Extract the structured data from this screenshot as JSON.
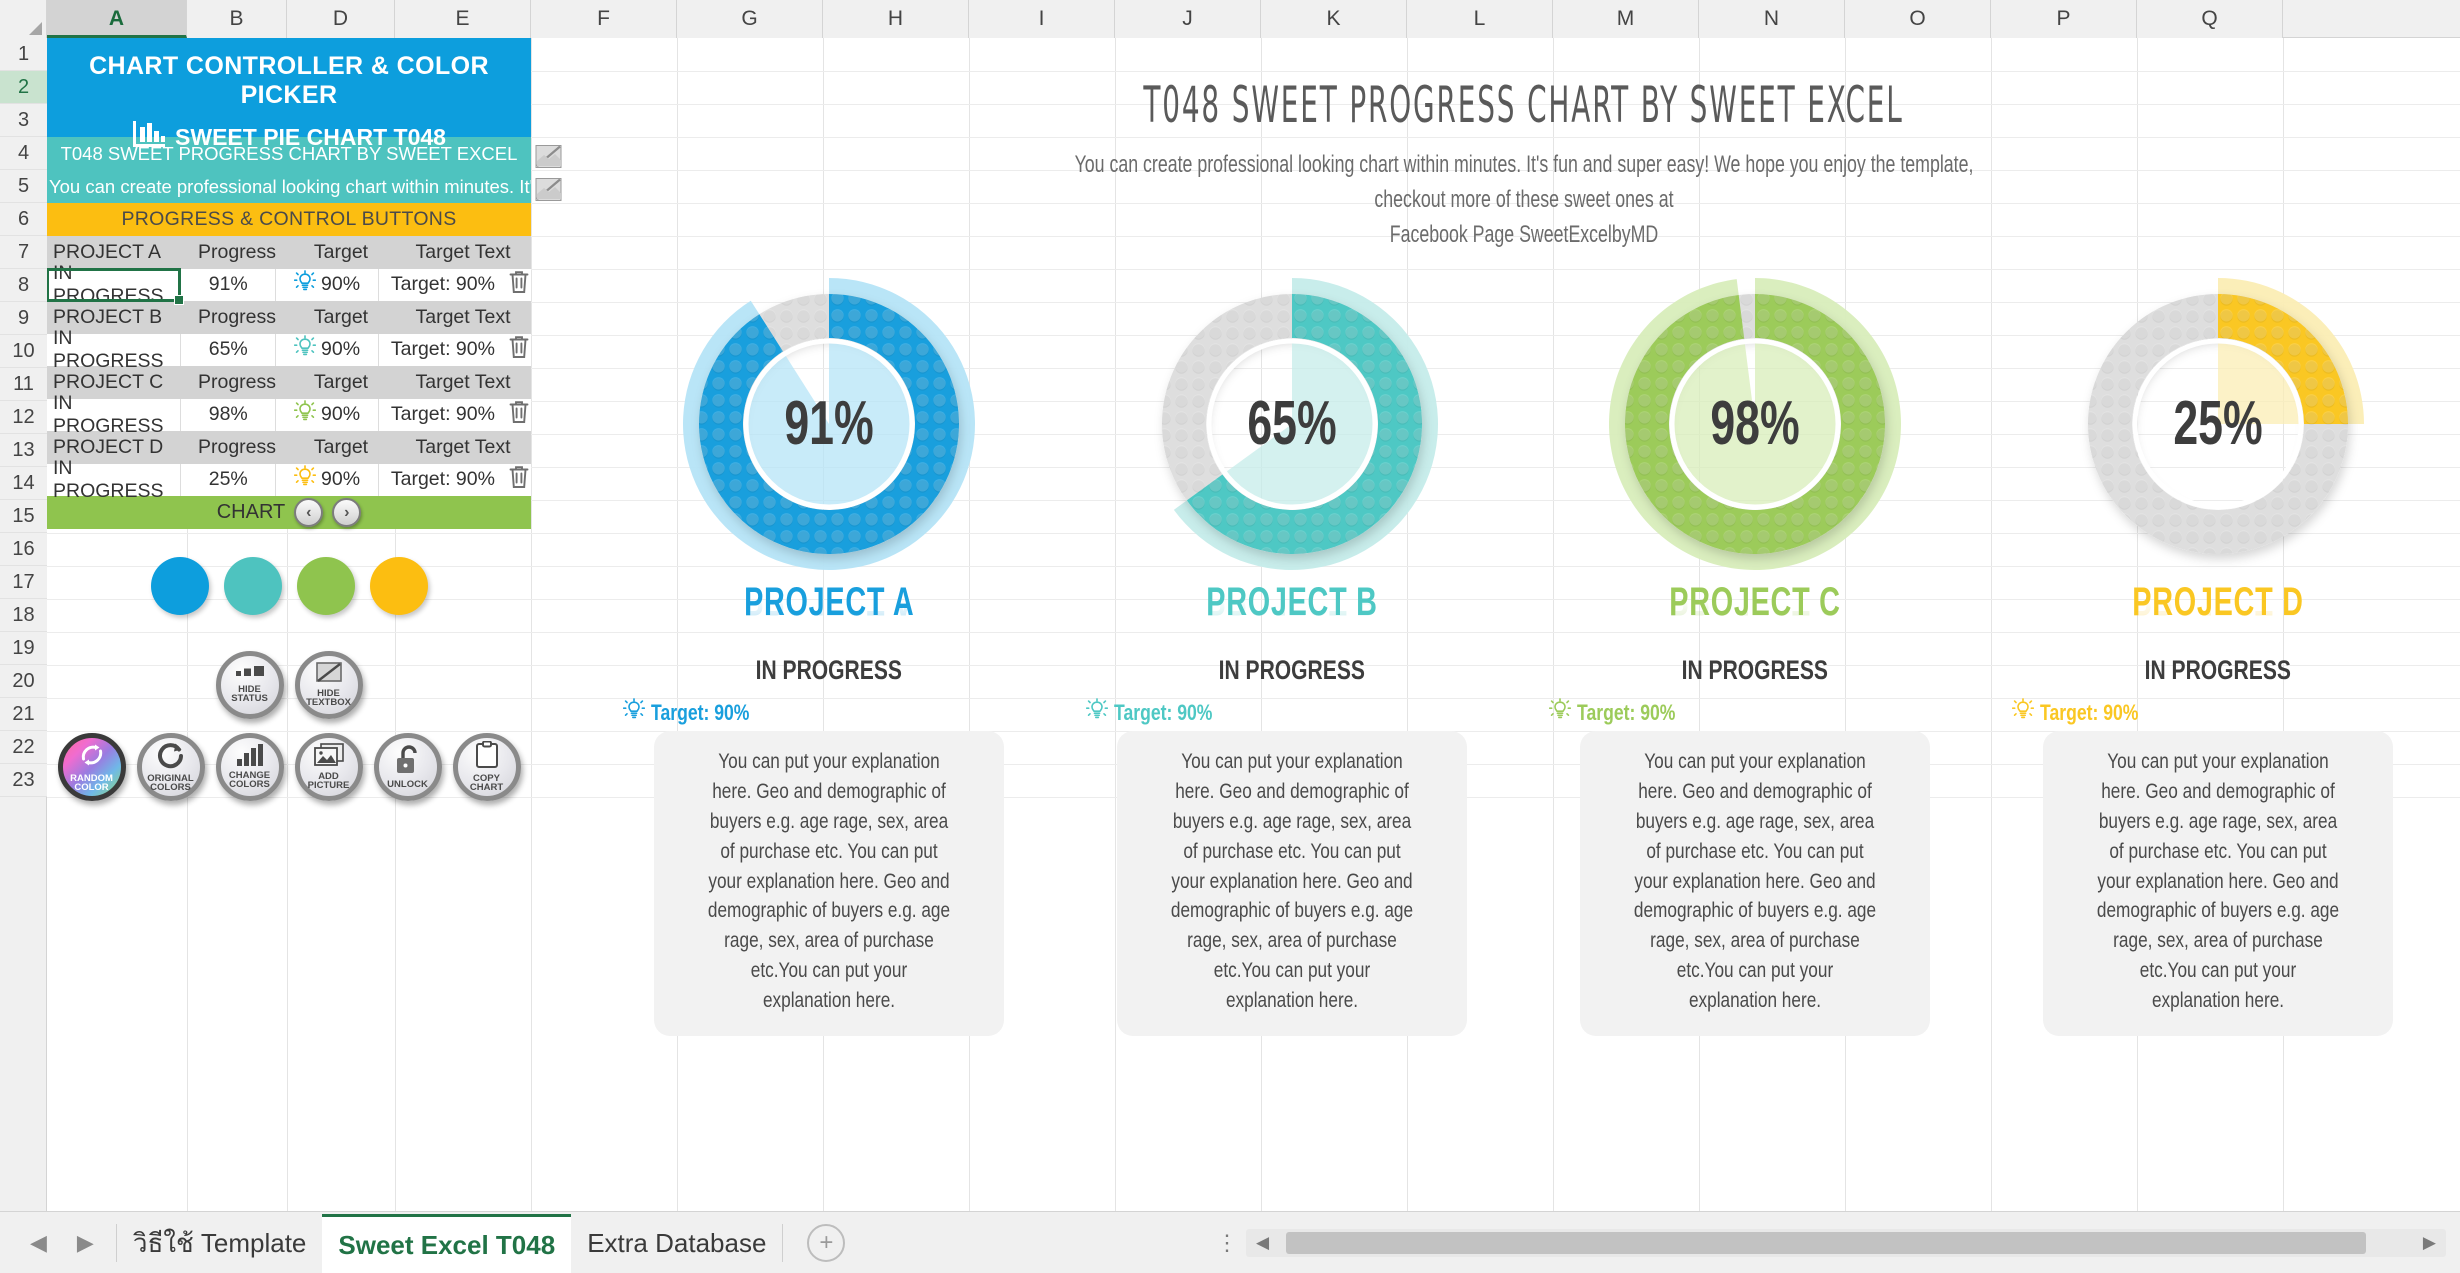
{
  "app": {
    "columns": [
      "A",
      "B",
      "D",
      "E",
      "F",
      "G",
      "H",
      "I",
      "J",
      "K",
      "L",
      "M",
      "N",
      "O",
      "P",
      "Q"
    ],
    "selected_column": "A",
    "rows": [
      "1",
      "2",
      "3",
      "4",
      "5",
      "6",
      "7",
      "8",
      "9",
      "10",
      "11",
      "12",
      "13",
      "14",
      "15",
      "16",
      "17",
      "18",
      "19",
      "20",
      "21",
      "22",
      "23"
    ],
    "selected_row": "2"
  },
  "panel": {
    "header_line1": "CHART CONTROLLER & COLOR PICKER",
    "header_line2": "SWEET PIE CHART T048",
    "bars_icon": "bar-chart-icon",
    "subtitle": "T048 SWEET PROGRESS CHART BY SWEET EXCEL",
    "description": "You can create professional looking chart within minutes. It's fun and",
    "section_label": "PROGRESS & CONTROL BUTTONS",
    "col_headers": {
      "progress": "Progress",
      "target": "Target",
      "target_text": "Target Text"
    },
    "projects": [
      {
        "name": "PROJECT A",
        "status": "IN PROGRESS",
        "progress": "91%",
        "target": "90%",
        "target_text": "Target: 90%",
        "color": "#0d9edd",
        "selected": true
      },
      {
        "name": "PROJECT B",
        "status": "IN PROGRESS",
        "progress": "65%",
        "target": "90%",
        "target_text": "Target: 90%",
        "color": "#4ec3bf",
        "selected": false
      },
      {
        "name": "PROJECT C",
        "status": "IN PROGRESS",
        "progress": "98%",
        "target": "90%",
        "target_text": "Target: 90%",
        "color": "#8fc44e",
        "selected": false
      },
      {
        "name": "PROJECT D",
        "status": "IN PROGRESS",
        "progress": "25%",
        "target": "90%",
        "target_text": "Target: 90%",
        "color": "#fcbe11",
        "selected": false
      }
    ],
    "chart_bar_label": "CHART",
    "nav_prev": "‹",
    "nav_next": "›",
    "swatches": [
      "#0d9edd",
      "#4ec3bf",
      "#8fc44e",
      "#fcbe11"
    ],
    "buttons_row1": [
      {
        "line1": "HIDE",
        "line2": "STATUS",
        "icon": "status-bars-icon"
      },
      {
        "line1": "HIDE",
        "line2": "TEXTBOX",
        "icon": "textbox-slash-icon"
      }
    ],
    "buttons_row2": [
      {
        "line1": "RANDOM",
        "line2": "COLOR",
        "icon": "refresh-circle-icon",
        "rainbow": true
      },
      {
        "line1": "ORIGINAL",
        "line2": "COLORS",
        "icon": "reset-arrow-icon",
        "rainbow": false
      },
      {
        "line1": "CHANGE",
        "line2": "COLORS",
        "icon": "bar-chart-icon",
        "rainbow": false
      },
      {
        "line1": "ADD",
        "line2": "PICTURE",
        "icon": "picture-icon",
        "rainbow": false
      },
      {
        "line1": "UNLOCK",
        "line2": "",
        "icon": "open-lock-icon",
        "rainbow": false
      },
      {
        "line1": "COPY",
        "line2": "CHART",
        "icon": "clipboard-icon",
        "rainbow": false
      }
    ],
    "delete_icon": "trash-icon",
    "bulb_icon": "lightbulb-icon",
    "edit_icon": "edit-picture-icon"
  },
  "dashboard": {
    "title": "T048 SWEET PROGRESS CHART BY SWEET EXCEL",
    "subtitle_line1": "You can create professional looking chart within minutes. It's fun and super easy! We hope you enjoy the template, checkout more of these sweet ones at",
    "subtitle_line2": "Facebook Page SweetExcelbyMD",
    "description_text": "You can put your explanation here. Geo and demographic of buyers e.g. age rage, sex, area of purchase etc. You can put your explanation here. Geo and demographic of buyers e.g. age rage, sex, area of purchase etc.You can put your explanation here."
  },
  "chart_data": {
    "type": "pie",
    "title": "T048 SWEET PROGRESS CHART BY SWEET EXCEL",
    "series": [
      {
        "name": "PROJECT A",
        "value": 91,
        "target": 90,
        "label": "91%",
        "color": "#199fdd",
        "track_color": "#dedede",
        "halo_color": "#b5e4f7",
        "status": "IN PROGRESS"
      },
      {
        "name": "PROJECT B",
        "value": 65,
        "target": 90,
        "label": "65%",
        "color": "#4ec8c4",
        "track_color": "#dedede",
        "halo_color": "#c5ecea",
        "status": "IN PROGRESS"
      },
      {
        "name": "PROJECT C",
        "value": 98,
        "target": 90,
        "label": "98%",
        "color": "#9ccb5a",
        "track_color": "#dedede",
        "halo_color": "#d8edba",
        "status": "IN PROGRESS"
      },
      {
        "name": "PROJECT D",
        "value": 25,
        "target": 90,
        "label": "25%",
        "color": "#fac723",
        "track_color": "#dedede",
        "halo_color": "#fbedb4",
        "status": "IN PROGRESS"
      }
    ],
    "max": 100,
    "units": "%",
    "legend": "none",
    "grid": false
  },
  "sheet_tabs": {
    "prev_arrow": "◀",
    "next_arrow": "▶",
    "tabs": [
      {
        "label": "วิธีใช้ Template",
        "active": false
      },
      {
        "label": "Sweet Excel T048",
        "active": true
      },
      {
        "label": "Extra Database",
        "active": false
      }
    ],
    "add_label": "+"
  }
}
